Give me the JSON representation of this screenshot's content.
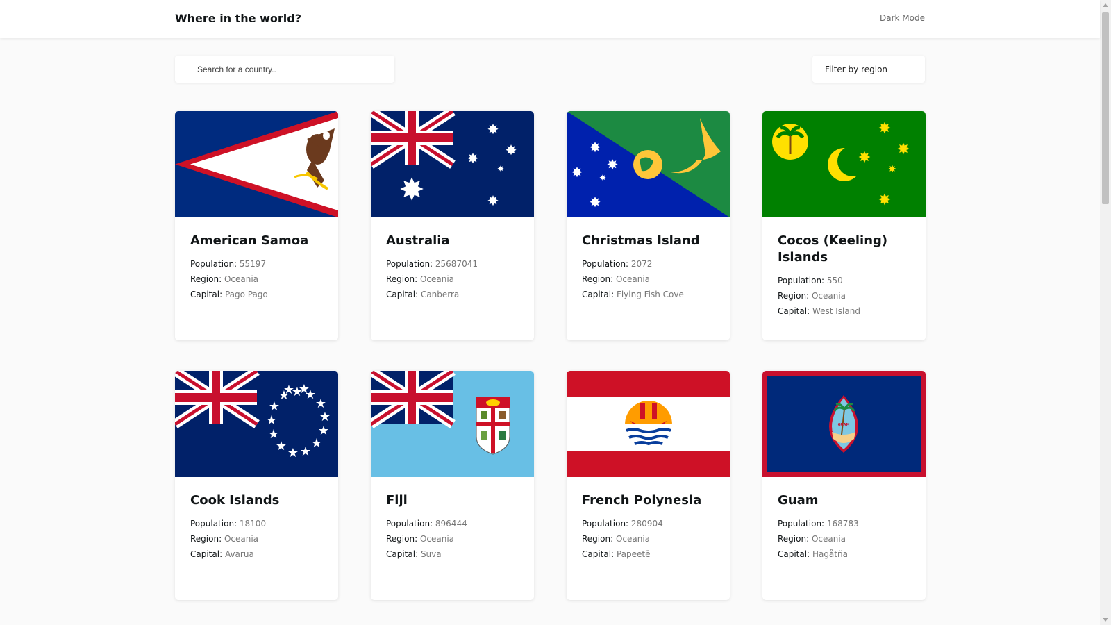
{
  "header": {
    "title": "Where in the world?",
    "mode_toggle": "Dark Mode"
  },
  "search": {
    "placeholder": "Search for a country..",
    "value": ""
  },
  "filter": {
    "label": "Filter by region"
  },
  "labels": {
    "population": "Population",
    "region": "Region",
    "capital": "Capital"
  },
  "countries": [
    {
      "name": "American Samoa",
      "population": "55197",
      "region": "Oceania",
      "capital": "Pago Pago",
      "flag_icon": "american-samoa-flag"
    },
    {
      "name": "Australia",
      "population": "25687041",
      "region": "Oceania",
      "capital": "Canberra",
      "flag_icon": "australia-flag"
    },
    {
      "name": "Christmas Island",
      "population": "2072",
      "region": "Oceania",
      "capital": "Flying Fish Cove",
      "flag_icon": "christmas-island-flag"
    },
    {
      "name": "Cocos (Keeling) Islands",
      "population": "550",
      "region": "Oceania",
      "capital": "West Island",
      "flag_icon": "cocos-keeling-islands-flag"
    },
    {
      "name": "Cook Islands",
      "population": "18100",
      "region": "Oceania",
      "capital": "Avarua",
      "flag_icon": "cook-islands-flag"
    },
    {
      "name": "Fiji",
      "population": "896444",
      "region": "Oceania",
      "capital": "Suva",
      "flag_icon": "fiji-flag"
    },
    {
      "name": "French Polynesia",
      "population": "280904",
      "region": "Oceania",
      "capital": "Papeetē",
      "flag_icon": "french-polynesia-flag"
    },
    {
      "name": "Guam",
      "population": "168783",
      "region": "Oceania",
      "capital": "Hagåtña",
      "flag_icon": "guam-flag"
    }
  ],
  "colors": {
    "background": "#fafafa",
    "card": "#ffffff",
    "text": "#111517",
    "muted": "#777777"
  }
}
